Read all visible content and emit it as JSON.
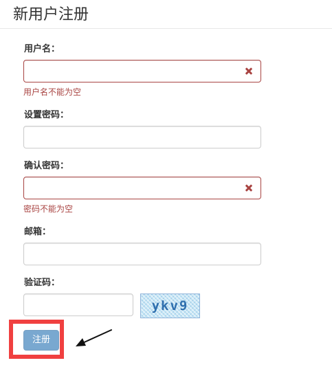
{
  "page": {
    "title": "新用户注册"
  },
  "form": {
    "username": {
      "label": "用户名：",
      "value": "",
      "error": "用户名不能为空"
    },
    "password": {
      "label": "设置密码：",
      "value": ""
    },
    "confirm_password": {
      "label": "确认密码：",
      "value": "",
      "error": "密码不能为空"
    },
    "email": {
      "label": "邮箱：",
      "value": ""
    },
    "captcha": {
      "label": "验证码：",
      "value": "",
      "image_text": "ykv9"
    },
    "submit_label": "注册"
  },
  "colors": {
    "error": "#a94442",
    "primary_button": "#337ab7",
    "annotation_box": "#f04040"
  },
  "icons": {
    "error_feedback": "close-icon",
    "annotation_arrow": "arrow-icon"
  }
}
